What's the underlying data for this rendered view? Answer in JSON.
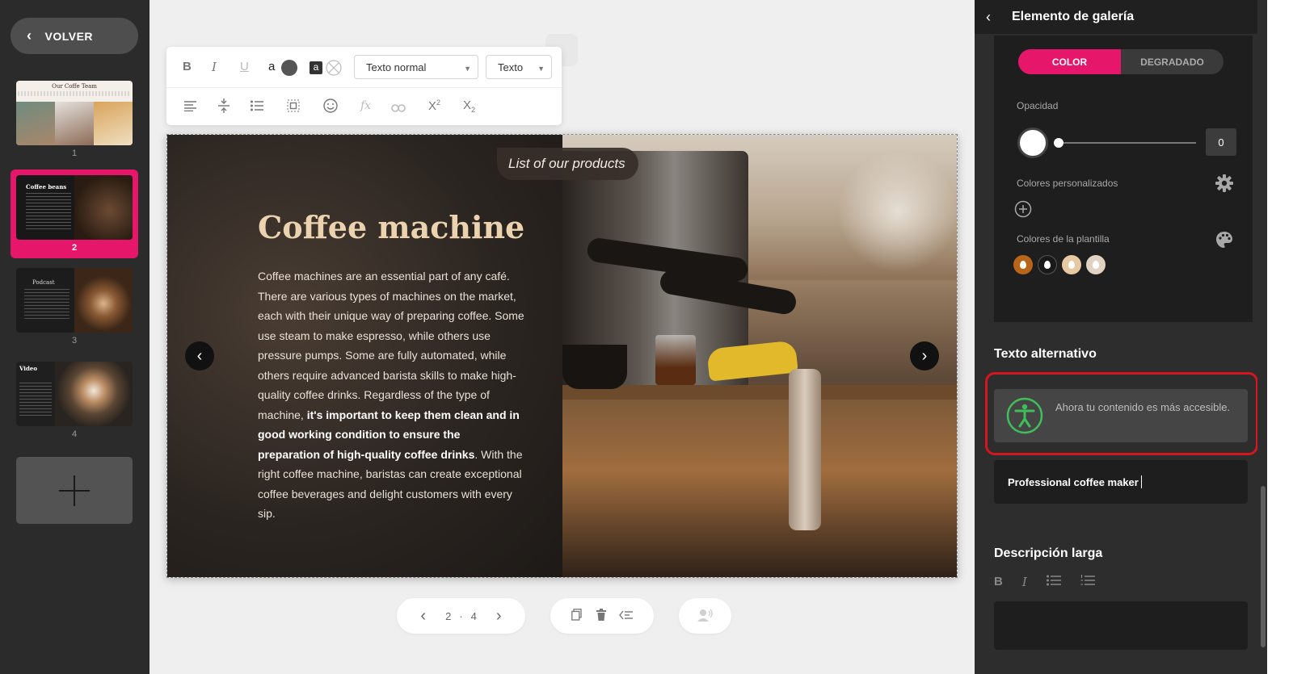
{
  "sidebar": {
    "back_label": "VOLVER",
    "slides": [
      {
        "number": "1",
        "title": "Our Coffe Team"
      },
      {
        "number": "2",
        "title": "Coffee beans"
      },
      {
        "number": "3",
        "title": "Podcast"
      },
      {
        "number": "4",
        "title": "Video"
      }
    ]
  },
  "toolbar": {
    "bold": "B",
    "italic": "I",
    "underline": "U",
    "font_color_letter": "a",
    "bg_color_letter": "a",
    "paragraph_style": "Texto normal",
    "text_type": "Texto",
    "formula": "fx",
    "superscript": "X",
    "superscript_mark": "2",
    "subscript": "X",
    "subscript_mark": "2"
  },
  "slide": {
    "tag": "List of our products",
    "heading": "Coffee machine",
    "body_before_bold": "Coffee machines are an essential part of any café. There are various types of machines on the market, each with their unique way of preparing coffee. Some use steam to make espresso, while others use pressure pumps. Some are fully automated, while others require advanced barista skills to make high-quality coffee drinks. Regardless of the type of machine, ",
    "body_bold": "it's important to keep them clean and in good working condition to ensure the preparation of high-quality coffee drinks",
    "body_after_bold": ". With the right coffee machine, baristas can create exceptional coffee beverages and delight customers with every sip."
  },
  "pagination": {
    "current": "2",
    "separator": "·",
    "total": "4"
  },
  "panel": {
    "title": "Elemento de galería",
    "tab_color": "COLOR",
    "tab_gradient": "DEGRADADO",
    "opacity_label": "Opacidad",
    "opacity_value": "0",
    "custom_colors_label": "Colores personalizados",
    "template_colors_label": "Colores de la plantilla",
    "template_colors": [
      "#b8651a",
      "#1a1a1a",
      "#e6c9a3",
      "#e0d3c4"
    ],
    "alt_text_heading": "Texto alternativo",
    "a11y_message": "Ahora tu contenido es más accesible.",
    "alt_text_value": "Professional coffee maker",
    "long_desc_heading": "Descripción larga"
  },
  "colors": {
    "accent": "#e6176b",
    "highlight_outline": "#d6151f",
    "a11y_icon": "#3fbf5a"
  }
}
